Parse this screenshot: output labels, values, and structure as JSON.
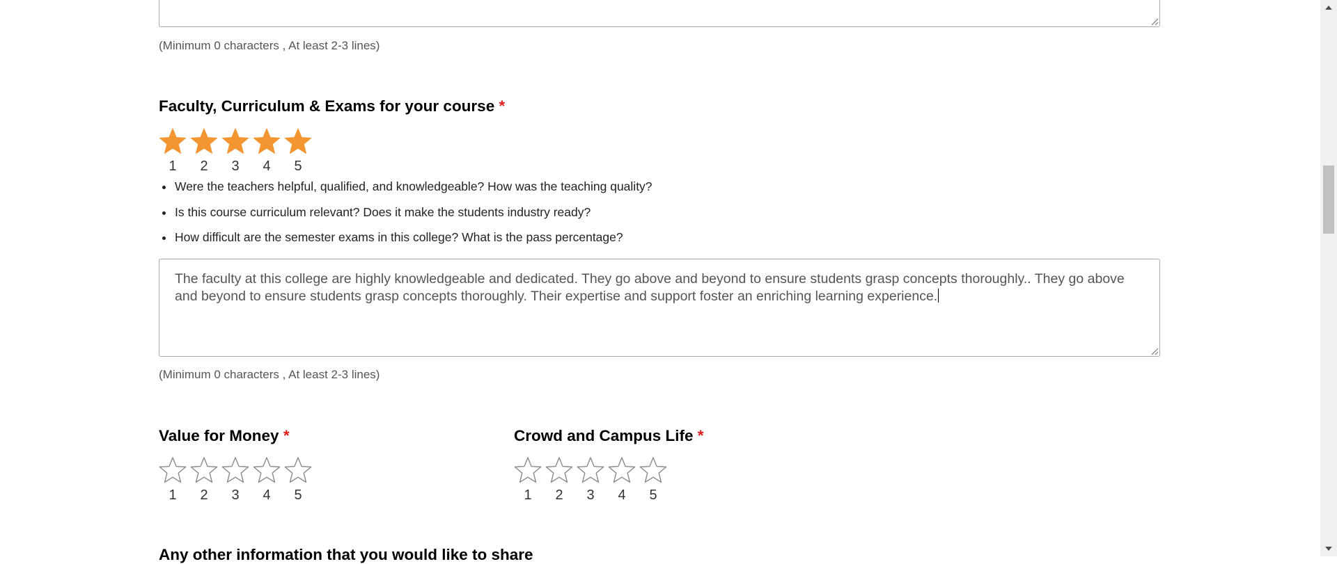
{
  "top_field": {
    "hint": "(Minimum 0 characters , At least 2-3 lines)"
  },
  "faculty": {
    "title": "Faculty, Curriculum & Exams for your course",
    "required_mark": "*",
    "rating": 5,
    "star_labels": [
      "1",
      "2",
      "3",
      "4",
      "5"
    ],
    "tips": [
      "Were the teachers helpful, qualified, and knowledgeable? How was the teaching quality?",
      "Is this course curriculum relevant? Does it make the students industry ready?",
      "How difficult are the semester exams in this college? What is the pass percentage?"
    ],
    "review_text": "The faculty at this college are highly knowledgeable and dedicated. They go above and beyond to ensure students grasp concepts thoroughly.. They go above and beyond to ensure students grasp concepts thoroughly. Their expertise and support foster an enriching learning experience.",
    "hint": "(Minimum 0 characters , At least 2-3 lines)"
  },
  "value_for_money": {
    "title": "Value for Money",
    "required_mark": "*",
    "rating": 0,
    "star_labels": [
      "1",
      "2",
      "3",
      "4",
      "5"
    ]
  },
  "campus_life": {
    "title": "Crowd and Campus Life",
    "required_mark": "*",
    "rating": 0,
    "star_labels": [
      "1",
      "2",
      "3",
      "4",
      "5"
    ]
  },
  "next_question": {
    "title": "Any other information that you would like to share"
  },
  "colors": {
    "star_filled": "#f39530",
    "star_empty_stroke": "#8a8a8a",
    "required": "#e31b1b"
  }
}
